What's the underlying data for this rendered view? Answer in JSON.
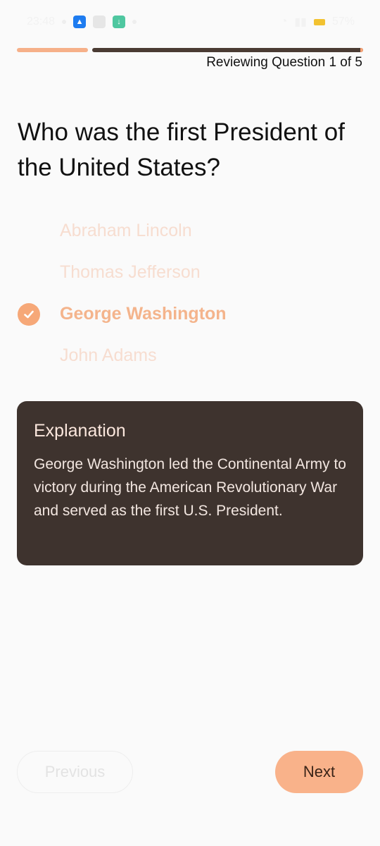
{
  "status_bar": {
    "time": "23:48",
    "battery": "57%",
    "icons": [
      "app-icon",
      "calendar-icon",
      "download-icon",
      "dot-icon",
      "wifi-icon",
      "signal-icon",
      "battery-icon"
    ]
  },
  "progress": {
    "label": "Reviewing Question 1 of 5",
    "current": 1,
    "total": 5
  },
  "question": {
    "text": "Who was the first President of the United States?"
  },
  "options": [
    {
      "label": "Abraham Lincoln",
      "correct": false
    },
    {
      "label": "Thomas Jefferson",
      "correct": false
    },
    {
      "label": "George Washington",
      "correct": true
    },
    {
      "label": "John Adams",
      "correct": false
    }
  ],
  "explanation": {
    "title": "Explanation",
    "body": "George Washington led the Continental Army to victory during the American Revolutionary War and served as the first U.S. President."
  },
  "nav": {
    "previous_label": "Previous",
    "next_label": "Next"
  },
  "colors": {
    "accent": "#f6a878",
    "dark_card": "#3e332e",
    "background": "#fafafa"
  }
}
